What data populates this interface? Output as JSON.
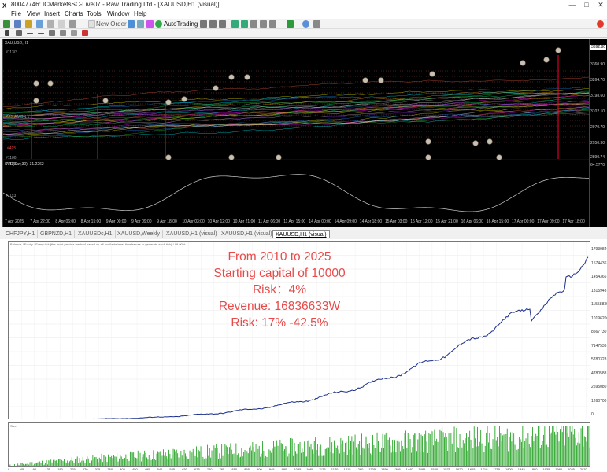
{
  "window": {
    "title": "80047746: ICMarketsSC-Live07 - Raw Trading Ltd - [XAUUSD,H1 (visual)]",
    "app_logo": "X",
    "controls": [
      "—",
      "□",
      "✕"
    ]
  },
  "menu": [
    "File",
    "View",
    "Insert",
    "Charts",
    "Tools",
    "Window",
    "Help"
  ],
  "toolbar": {
    "new_order_label": "New Order",
    "autotrading_label": "AutoTrading"
  },
  "chart_top": {
    "symbol_label": "XAU,USD,H1",
    "indicator_label": "SVC(Sav,30): 31.2262",
    "left_labels": [
      "#113/3",
      "PXS AMON:1",
      "#425",
      "#1100",
      "#1101",
      "#11x3"
    ],
    "price_labels": [
      "3392.80",
      "3360.90",
      "3264.70",
      "3198.60",
      "3102.10",
      "2970.70",
      "2950.30",
      "2890.74"
    ],
    "indicator_value": "64.5770",
    "time_labels": [
      "7 Apr 2025",
      "7 Apr 22:00",
      "8 Apr 06:00",
      "8 Apr 15:00",
      "9 Apr 00:00",
      "9 Apr 09:00",
      "9 Apr 18:00",
      "10 Apr 03:00",
      "10 Apr 12:00",
      "10 Apr 21:00",
      "11 Apr 06:00",
      "11 Apr 15:00",
      "14 Apr 00:00",
      "14 Apr 09:00",
      "14 Apr 18:00",
      "15 Apr 03:00",
      "15 Apr 12:00",
      "15 Apr 21:00",
      "16 Apr 06:00",
      "16 Apr 15:00",
      "17 Apr 00:00",
      "17 Apr 09:00",
      "17 Apr 18:00"
    ]
  },
  "tabs": [
    {
      "label": "CHFJPY,H1",
      "active": false
    },
    {
      "label": "GBPNZD,H1",
      "active": false
    },
    {
      "label": "XAUUSDc,H1",
      "active": false
    },
    {
      "label": "XAUUSD,Weekly",
      "active": false
    },
    {
      "label": "XAUUSD,H1 (visual)",
      "active": false
    },
    {
      "label": "XAUUSD,H1 (visual)",
      "active": false
    },
    {
      "label": "XAUUSD,H1 (visual)",
      "active": true
    }
  ],
  "report": {
    "header": "Balance / Equity / Every tick (the most precise method based on all available least timeframes to generate each tick) / 99.90%",
    "y_labels": [
      "17939846",
      "15744367",
      "14543667",
      "13159487",
      "11558830",
      "10196200",
      "8567730",
      "7147536",
      "5780328",
      "4780588",
      "2595080",
      "1260700",
      "0"
    ],
    "x_labels": [
      "0",
      "45",
      "90",
      "135",
      "180",
      "225",
      "270",
      "315",
      "360",
      "405",
      "450",
      "495",
      "540",
      "585",
      "630",
      "675",
      "720",
      "765",
      "810",
      "855",
      "900",
      "945",
      "990",
      "1035",
      "1080",
      "1125",
      "1170",
      "1215",
      "1260",
      "1305",
      "1350",
      "1395",
      "1440",
      "1485",
      "1530",
      "1575",
      "1620",
      "1665",
      "1710",
      "1755",
      "1800",
      "1845",
      "1890",
      "1935",
      "1980",
      "2025",
      "2070"
    ],
    "volume_label": "Size"
  },
  "overlay": {
    "line1": "From 2010 to 2025",
    "line2": "Starting capital of 10000",
    "line3": "Risk：4%",
    "line4": "Revenue: 16836633W",
    "line5": "Risk: 17% -42.5%",
    "color": "#e84a4a"
  }
}
